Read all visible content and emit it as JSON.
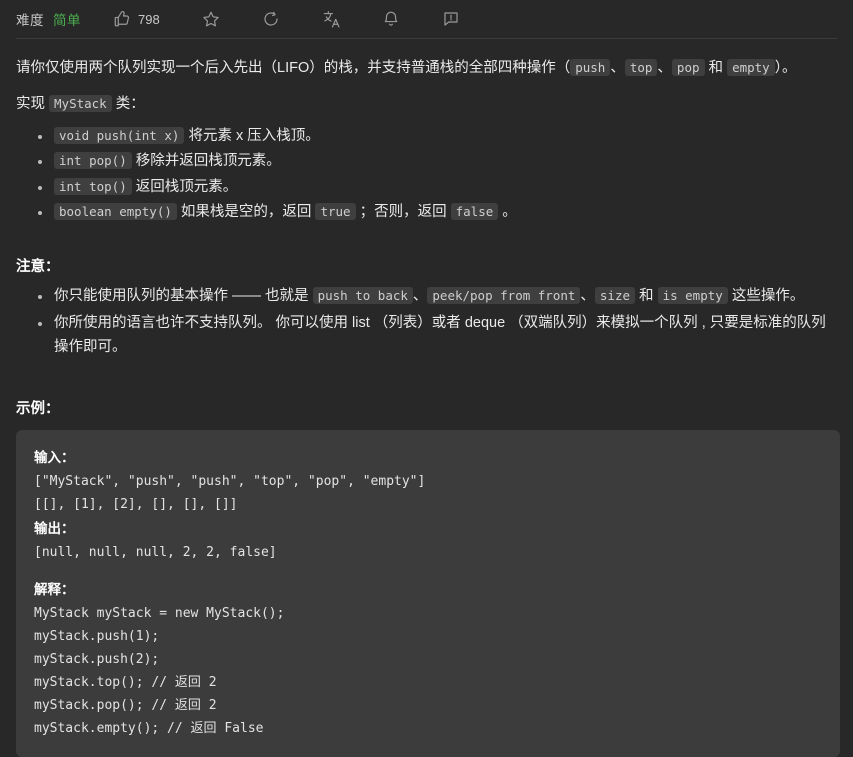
{
  "toolbar": {
    "difficulty_label": "难度",
    "difficulty_value": "简单",
    "difficulty_color": "#4caf50",
    "like_count": "798",
    "icons": {
      "thumbs_up": "thumbs-up-icon",
      "star": "star-icon",
      "share": "share-refresh-icon",
      "translate": "translate-icon",
      "bell": "bell-icon",
      "comment": "comment-icon"
    }
  },
  "problem": {
    "intro_1": "请你仅使用两个队列实现一个后入先出（LIFO）的栈，并支持普通栈的全部四种操作（",
    "intro_code_1": "push",
    "intro_sep_1": "、",
    "intro_code_2": "top",
    "intro_sep_2": "、",
    "intro_code_3": "pop",
    "intro_sep_3": " 和 ",
    "intro_code_4": "empty",
    "intro_2": "）。",
    "implement_prefix": "实现 ",
    "implement_class": "MyStack",
    "implement_suffix": " 类：",
    "methods": [
      {
        "code": "void push(int x)",
        "text": " 将元素 x 压入栈顶。"
      },
      {
        "code": "int pop()",
        "text": " 移除并返回栈顶元素。"
      },
      {
        "code": "int top()",
        "text": " 返回栈顶元素。"
      },
      {
        "code": "boolean empty()",
        "text_a": " 如果栈是空的，返回 ",
        "code_true": "true",
        "text_b": " ；否则，返回 ",
        "code_false": "false",
        "text_c": " 。"
      }
    ]
  },
  "notes": {
    "heading": "注意：",
    "item1": {
      "a": "你只能使用队列的基本操作 —— 也就是 ",
      "c1": "push to back",
      "b": "、",
      "c2": "peek/pop from front",
      "c": "、",
      "c3": "size",
      "d": " 和 ",
      "c4": "is empty",
      "e": " 这些操作。"
    },
    "item2": "你所使用的语言也许不支持队列。 你可以使用 list （列表）或者 deque （双端队列）来模拟一个队列 , 只要是标准的队列操作即可。"
  },
  "example": {
    "heading": "示例：",
    "input_label": "输入：",
    "input_lines": [
      "[\"MyStack\", \"push\", \"push\", \"top\", \"pop\", \"empty\"]",
      "[[], [1], [2], [], [], []]"
    ],
    "output_label": "输出：",
    "output_lines": [
      "[null, null, null, 2, 2, false]"
    ],
    "explain_label": "解释：",
    "explain_lines": [
      "MyStack myStack = new MyStack();",
      "myStack.push(1);",
      "myStack.push(2);",
      "myStack.top(); // 返回 2",
      "myStack.pop(); // 返回 2",
      "myStack.empty(); // 返回 False"
    ]
  }
}
